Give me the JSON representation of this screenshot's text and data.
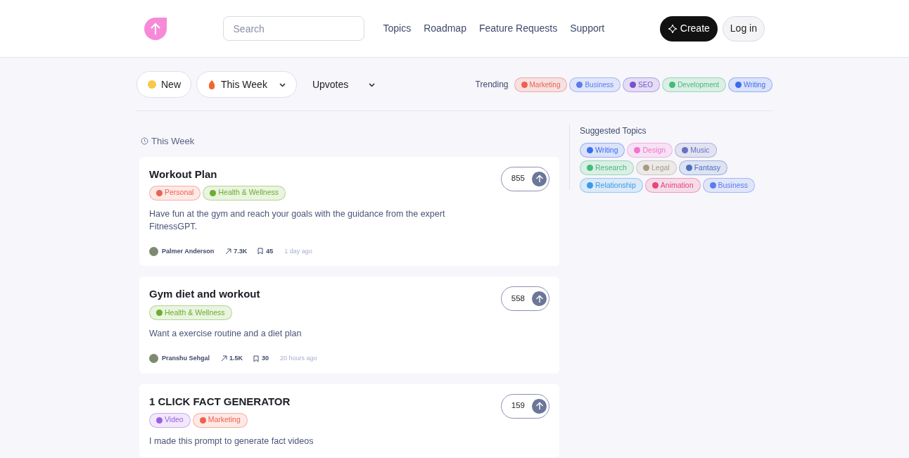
{
  "header": {
    "search": {
      "placeholder": "Search"
    },
    "nav": [
      "Topics",
      "Roadmap",
      "Feature Requests",
      "Support"
    ],
    "create": "Create",
    "login": "Log in"
  },
  "filters": [
    {
      "label": "New",
      "kind": "pill"
    },
    {
      "label": "This Week",
      "kind": "pill-dropdown"
    },
    {
      "label": "Upvotes",
      "kind": "dropdown"
    }
  ],
  "trending": {
    "label": "Trending",
    "tags": [
      {
        "label": "Marketing",
        "color": "#f0604d"
      },
      {
        "label": "Business",
        "color": "#5b7cf0"
      },
      {
        "label": "SEO",
        "color": "#7a4fd0"
      },
      {
        "label": "Development",
        "color": "#3fbf74"
      },
      {
        "label": "Writing",
        "color": "#3a6df0"
      }
    ]
  },
  "section_title": "This Week",
  "posts": [
    {
      "title": "Workout Plan",
      "votes": "855",
      "tags": [
        {
          "label": "Personal",
          "color": "#f0604d"
        },
        {
          "label": "Health & Wellness",
          "color": "#6aaf2a"
        }
      ],
      "description": "Have fun at the gym and reach your goals with the guidance from the expert FitnessGPT.",
      "author": "Palmer Anderson",
      "views": "7.3K",
      "saves": "45",
      "time": "1 day ago"
    },
    {
      "title": "Gym diet and workout",
      "votes": "558",
      "tags": [
        {
          "label": "Health & Wellness",
          "color": "#6aaf2a"
        }
      ],
      "description": "Want a exercise routine and a diet plan",
      "author": "Pranshu Sehgal",
      "views": "1.5K",
      "saves": "30",
      "time": "20 hours ago"
    },
    {
      "title": "1 CLICK FACT GENERATOR",
      "votes": "159",
      "tags": [
        {
          "label": "Video",
          "color": "#9b5de5"
        },
        {
          "label": "Marketing",
          "color": "#f0604d"
        }
      ],
      "description": "I made this prompt to generate fact videos"
    }
  ],
  "suggested": {
    "title": "Suggested Topics",
    "tags": [
      {
        "label": "Writing",
        "color": "#3a6df0"
      },
      {
        "label": "Design",
        "color": "#f472d0"
      },
      {
        "label": "Music",
        "color": "#6b6fc0"
      },
      {
        "label": "Research",
        "color": "#3fbf74"
      },
      {
        "label": "Legal",
        "color": "#a89a80"
      },
      {
        "label": "Fantasy",
        "color": "#4a6fc0"
      },
      {
        "label": "Relationship",
        "color": "#3b9ae8"
      },
      {
        "label": "Animation",
        "color": "#e8457a"
      },
      {
        "label": "Business",
        "color": "#5b7cf0"
      }
    ]
  }
}
